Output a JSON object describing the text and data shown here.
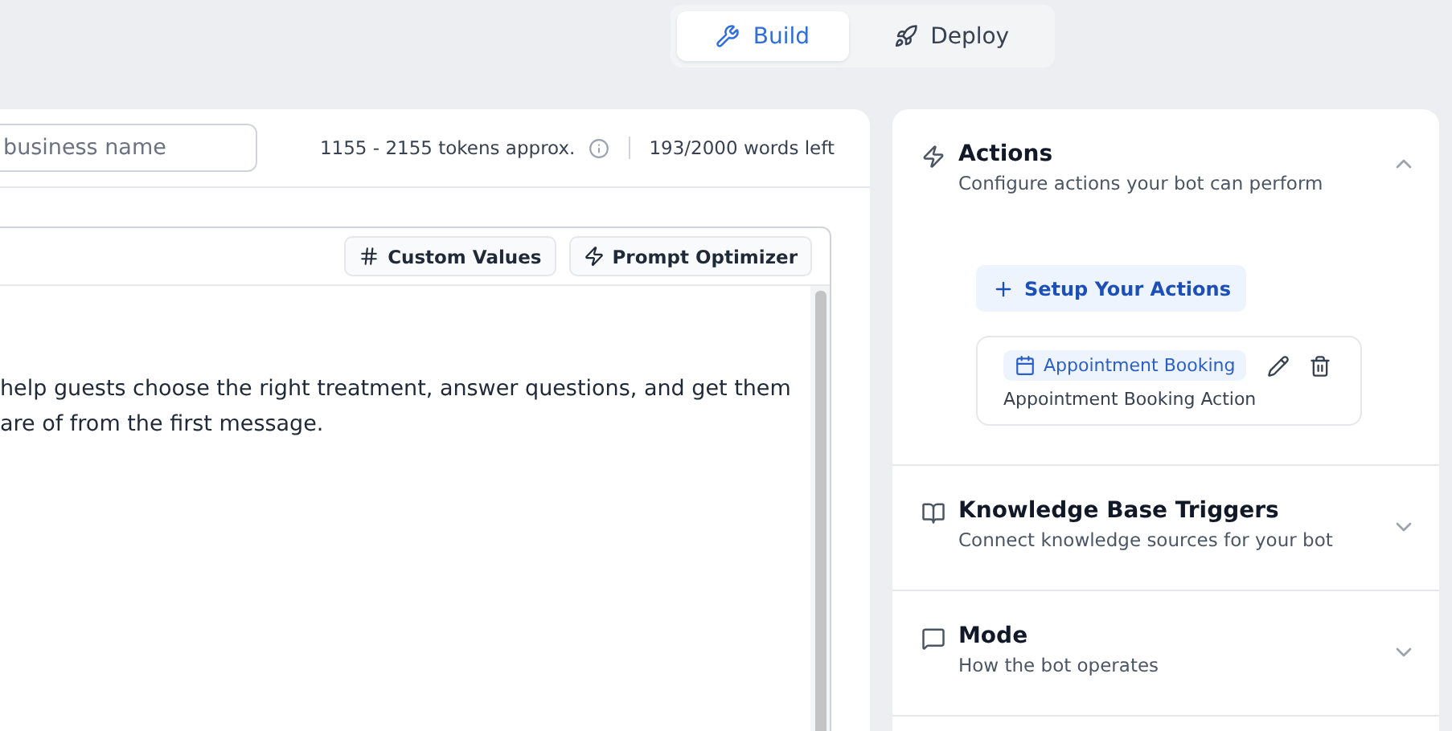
{
  "tabs": [
    {
      "label": "Build",
      "selected": true
    },
    {
      "label": "Deploy",
      "selected": false
    }
  ],
  "editor": {
    "name_field": {
      "placeholder": "business name"
    },
    "tokens": "1155 - 2155 tokens approx.",
    "words_left": "193/2000 words left",
    "tools": [
      {
        "label": "Custom Values"
      },
      {
        "label": "Prompt Optimizer"
      }
    ],
    "lines": [
      "help guests choose the right treatment, answer questions, and get them",
      "are of from the first message."
    ]
  },
  "sections": [
    {
      "title": "Actions",
      "subtitle": "Configure actions your bot can perform",
      "expanded": true,
      "setup_button": "Setup Your Actions",
      "actions": [
        {
          "tag": "Appointment Booking",
          "description": "Appointment Booking Action"
        }
      ]
    },
    {
      "title": "Knowledge Base Triggers",
      "subtitle": "Connect knowledge sources for your bot",
      "expanded": false
    },
    {
      "title": "Mode",
      "subtitle": "How the bot operates",
      "expanded": false
    }
  ]
}
